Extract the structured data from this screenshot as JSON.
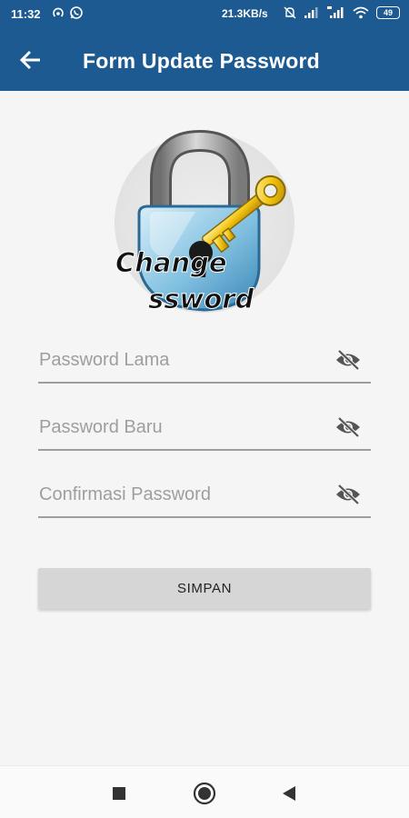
{
  "status_bar": {
    "time": "11:32",
    "network_speed": "21.3KB/s",
    "battery": "49",
    "icons": [
      "hotspot-icon",
      "whatsapp-icon",
      "mute-icon",
      "signal-icon",
      "signal-icon",
      "wifi-icon",
      "battery-icon"
    ]
  },
  "app_bar": {
    "title": "Form Update Password",
    "back_icon": "arrow-left-icon",
    "background_color": "#1d5a92"
  },
  "illustration": {
    "name": "change-password-lock-illustration",
    "text_line1": "Change",
    "text_line2": "ssword"
  },
  "form": {
    "old_password": {
      "placeholder": "Password Lama",
      "value": "",
      "toggle_icon": "eye-off-icon"
    },
    "new_password": {
      "placeholder": "Password Baru",
      "value": "",
      "toggle_icon": "eye-off-icon"
    },
    "confirm_password": {
      "placeholder": "Confirmasi Password",
      "value": "",
      "toggle_icon": "eye-off-icon"
    },
    "submit_label": "SIMPAN"
  },
  "nav_bar": {
    "buttons": [
      "recents-square-icon",
      "home-circle-icon",
      "back-triangle-icon"
    ]
  }
}
